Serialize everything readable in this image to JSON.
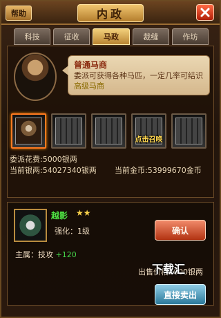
{
  "topbar": {
    "help_label": "帮助",
    "title": "内政",
    "close_icon": "close-icon"
  },
  "tabs": [
    {
      "label": "科技",
      "active": false
    },
    {
      "label": "征收",
      "active": false
    },
    {
      "label": "马政",
      "active": true
    },
    {
      "label": "裁缝",
      "active": false
    },
    {
      "label": "作坊",
      "active": false
    }
  ],
  "merchant": {
    "name": "普通马商",
    "text": "委派可获得各种马匹，一定几率可结识",
    "highlight": "高级马商",
    "portrait_icon": "merchant-portrait"
  },
  "slots": [
    {
      "name": "slot-merchant",
      "selected": true,
      "label": ""
    },
    {
      "name": "slot-empty-1",
      "selected": false,
      "label": ""
    },
    {
      "name": "slot-empty-2",
      "selected": false,
      "label": ""
    },
    {
      "name": "slot-empty-3",
      "selected": false,
      "label": "点击召唤"
    },
    {
      "name": "slot-empty-4",
      "selected": false,
      "label": ""
    }
  ],
  "costs": {
    "dispatch_cost": "委派花费:5000银两",
    "silver": "当前银两:54027340银两",
    "gold": "当前金币:53999670金币"
  },
  "horse": {
    "name": "越影",
    "stars": "★★",
    "strength": "强化：1级",
    "main_attr_label": "主属：技攻",
    "main_attr_value": "+120"
  },
  "buttons": {
    "confirm": "确认",
    "sell": "直接卖出"
  },
  "sell": {
    "label": "出售价格",
    "value": "1000银两",
    "watermark": "下载汇"
  },
  "colors": {
    "accent": "#f0c56f",
    "close": "#d93a18",
    "green": "#45d64b"
  }
}
